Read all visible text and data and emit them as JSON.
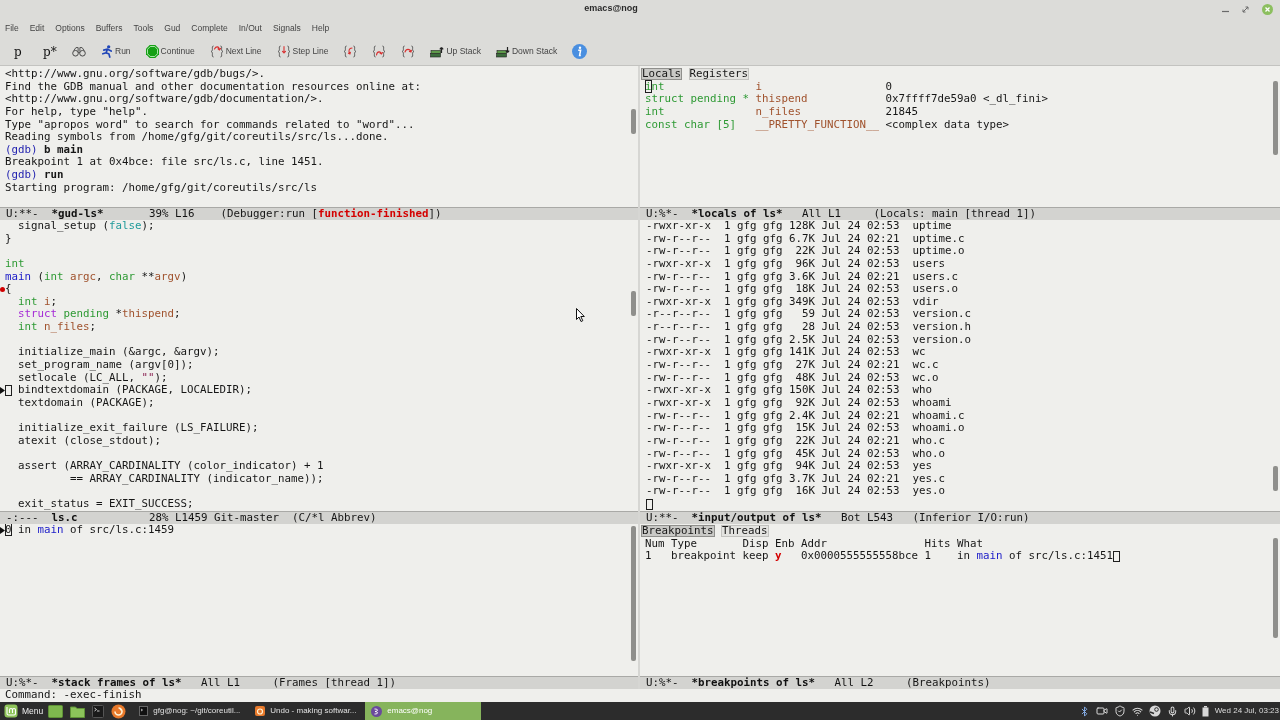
{
  "window": {
    "title": "emacs@nog"
  },
  "menu_bar": [
    "File",
    "Edit",
    "Options",
    "Buffers",
    "Tools",
    "Gud",
    "Complete",
    "In/Out",
    "Signals",
    "Help"
  ],
  "toolbar": [
    {
      "kind": "glyph",
      "label": "p"
    },
    {
      "kind": "glyph",
      "label": "p*"
    },
    {
      "kind": "icon"
    },
    {
      "kind": "labeled",
      "label": "Run"
    },
    {
      "kind": "labeled",
      "label": "Continue"
    },
    {
      "kind": "labeled",
      "label": "Next Line"
    },
    {
      "kind": "labeled",
      "label": "Step Line"
    },
    {
      "kind": "icon"
    },
    {
      "kind": "icon"
    },
    {
      "kind": "icon"
    },
    {
      "kind": "labeled",
      "label": "Up Stack"
    },
    {
      "kind": "labeled",
      "label": "Down Stack"
    },
    {
      "kind": "icon"
    }
  ],
  "gud_console": {
    "lines": [
      {
        "kind": "output",
        "text": "<http://www.gnu.org/software/gdb/bugs/>."
      },
      {
        "kind": "output",
        "text": "Find the GDB manual and other documentation resources online at:"
      },
      {
        "kind": "output",
        "text": "<http://www.gnu.org/software/gdb/documentation/>."
      },
      {
        "kind": "output",
        "text": "For help, type \"help\"."
      },
      {
        "kind": "output",
        "text": "Type \"apropos word\" to search for commands related to \"word\"..."
      },
      {
        "kind": "output",
        "text": "Reading symbols from /home/gfg/git/coreutils/src/ls...done."
      },
      {
        "kind": "command",
        "prompt": "(gdb)",
        "text": "b main"
      },
      {
        "kind": "output",
        "text": "Breakpoint 1 at 0x4bce: file src/ls.c, line 1451."
      },
      {
        "kind": "command",
        "prompt": "(gdb)",
        "text": "run"
      },
      {
        "kind": "output",
        "text": "Starting program: /home/gfg/git/coreutils/src/ls"
      }
    ],
    "mode_line": {
      "status": "U:**-",
      "buffer": "*gud-ls*",
      "position": "39% L16",
      "mode": [
        {
          "text": "(Debugger:run [",
          "kind": "plain"
        },
        {
          "text": "function-finished",
          "kind": "alert"
        },
        {
          "text": "])",
          "kind": "plain"
        }
      ]
    }
  },
  "locals": {
    "tabs": [
      {
        "label": "Locals",
        "selected": true
      },
      {
        "label": "Registers",
        "selected": false
      }
    ],
    "rows": [
      {
        "type": "int",
        "name": "i",
        "value": "0",
        "cursor": true
      },
      {
        "type": "struct pending *",
        "name": "thispend",
        "value": "0x7ffff7de59a0 <_dl_fini>",
        "cursor": false
      },
      {
        "type": "int",
        "name": "n_files",
        "value": "21845",
        "cursor": false
      },
      {
        "type": "const char [5]",
        "name": "__PRETTY_FUNCTION__",
        "value": "<complex data type>",
        "cursor": false
      }
    ],
    "mode_line": {
      "status": "U:%*-",
      "buffer": "*locals of ls*",
      "position": "All L1",
      "mode": [
        {
          "text": "(Locals: main [thread 1])",
          "kind": "plain"
        }
      ]
    }
  },
  "source": {
    "lines": [
      {
        "kind": "code",
        "breakpoint": false,
        "current": false,
        "cursor": false,
        "segments": [
          {
            "text": "  signal_setup (",
            "kind": "plain"
          },
          {
            "text": "false",
            "kind": "constant"
          },
          {
            "text": ");",
            "kind": "plain"
          }
        ]
      },
      {
        "kind": "code",
        "breakpoint": false,
        "current": false,
        "cursor": false,
        "segments": [
          {
            "text": "}",
            "kind": "plain"
          }
        ]
      },
      {
        "kind": "blank",
        "breakpoint": false,
        "current": false,
        "cursor": false
      },
      {
        "kind": "code",
        "breakpoint": false,
        "current": false,
        "cursor": false,
        "segments": [
          {
            "text": "int",
            "kind": "type"
          }
        ]
      },
      {
        "kind": "code",
        "breakpoint": false,
        "current": false,
        "cursor": false,
        "segments": [
          {
            "text": "main",
            "kind": "function"
          },
          {
            "text": " (",
            "kind": "plain"
          },
          {
            "text": "int",
            "kind": "type"
          },
          {
            "text": " argc",
            "kind": "variable"
          },
          {
            "text": ", ",
            "kind": "plain"
          },
          {
            "text": "char",
            "kind": "type"
          },
          {
            "text": " **",
            "kind": "plain"
          },
          {
            "text": "argv",
            "kind": "variable"
          },
          {
            "text": ")",
            "kind": "plain"
          }
        ]
      },
      {
        "kind": "code",
        "breakpoint": true,
        "current": false,
        "cursor": false,
        "segments": [
          {
            "text": "{",
            "kind": "plain"
          }
        ]
      },
      {
        "kind": "code",
        "breakpoint": false,
        "current": false,
        "cursor": false,
        "segments": [
          {
            "text": "  int",
            "kind": "type"
          },
          {
            "text": " i",
            "kind": "variable"
          },
          {
            "text": ";",
            "kind": "plain"
          }
        ]
      },
      {
        "kind": "code",
        "breakpoint": false,
        "current": false,
        "cursor": false,
        "segments": [
          {
            "text": "  struct",
            "kind": "keyword"
          },
          {
            "text": " pending",
            "kind": "type"
          },
          {
            "text": " *",
            "kind": "plain"
          },
          {
            "text": "thispend",
            "kind": "variable"
          },
          {
            "text": ";",
            "kind": "plain"
          }
        ]
      },
      {
        "kind": "code",
        "breakpoint": false,
        "current": false,
        "cursor": false,
        "segments": [
          {
            "text": "  int",
            "kind": "type"
          },
          {
            "text": " n_files",
            "kind": "variable"
          },
          {
            "text": ";",
            "kind": "plain"
          }
        ]
      },
      {
        "kind": "blank",
        "breakpoint": false,
        "current": false,
        "cursor": false
      },
      {
        "kind": "code",
        "breakpoint": false,
        "current": false,
        "cursor": false,
        "segments": [
          {
            "text": "  initialize_main (&argc, &argv);",
            "kind": "plain"
          }
        ]
      },
      {
        "kind": "code",
        "breakpoint": false,
        "current": false,
        "cursor": false,
        "segments": [
          {
            "text": "  set_program_name (argv[0]);",
            "kind": "plain"
          }
        ]
      },
      {
        "kind": "code",
        "breakpoint": false,
        "current": false,
        "cursor": false,
        "segments": [
          {
            "text": "  setlocale (LC_ALL, ",
            "kind": "plain"
          },
          {
            "text": "\"\"",
            "kind": "string"
          },
          {
            "text": ");",
            "kind": "plain"
          }
        ]
      },
      {
        "kind": "code",
        "breakpoint": false,
        "current": true,
        "cursor": true,
        "segments": [
          {
            "text": "  bindtextdomain (PACKAGE, LOCALEDIR);",
            "kind": "plain"
          }
        ]
      },
      {
        "kind": "code",
        "breakpoint": false,
        "current": false,
        "cursor": false,
        "segments": [
          {
            "text": "  textdomain (PACKAGE);",
            "kind": "plain"
          }
        ]
      },
      {
        "kind": "blank",
        "breakpoint": false,
        "current": false,
        "cursor": false
      },
      {
        "kind": "code",
        "breakpoint": false,
        "current": false,
        "cursor": false,
        "segments": [
          {
            "text": "  initialize_exit_failure (LS_FAILURE);",
            "kind": "plain"
          }
        ]
      },
      {
        "kind": "code",
        "breakpoint": false,
        "current": false,
        "cursor": false,
        "segments": [
          {
            "text": "  atexit (close_stdout);",
            "kind": "plain"
          }
        ]
      },
      {
        "kind": "blank",
        "breakpoint": false,
        "current": false,
        "cursor": false
      },
      {
        "kind": "code",
        "breakpoint": false,
        "current": false,
        "cursor": false,
        "segments": [
          {
            "text": "  assert (ARRAY_CARDINALITY (color_indicator) + 1",
            "kind": "plain"
          }
        ]
      },
      {
        "kind": "code",
        "breakpoint": false,
        "current": false,
        "cursor": false,
        "segments": [
          {
            "text": "          == ARRAY_CARDINALITY (indicator_name));",
            "kind": "plain"
          }
        ]
      },
      {
        "kind": "blank",
        "breakpoint": false,
        "current": false,
        "cursor": false
      },
      {
        "kind": "code",
        "breakpoint": false,
        "current": false,
        "cursor": false,
        "segments": [
          {
            "text": "  exit_status = EXIT_SUCCESS;",
            "kind": "plain"
          }
        ]
      }
    ],
    "mode_line": {
      "status": "-:---",
      "buffer": "ls.c",
      "position": "28% L1459",
      "vc": "Git-master",
      "mode": [
        {
          "text": "(C/*l Abbrev)",
          "kind": "plain"
        }
      ]
    }
  },
  "inferior_io": {
    "lines": [
      "-rwxr-xr-x  1 gfg gfg 128K Jul 24 02:53  uptime",
      "-rw-r--r--  1 gfg gfg 6.7K Jul 24 02:21  uptime.c",
      "-rw-r--r--  1 gfg gfg  22K Jul 24 02:53  uptime.o",
      "-rwxr-xr-x  1 gfg gfg  96K Jul 24 02:53  users",
      "-rw-r--r--  1 gfg gfg 3.6K Jul 24 02:21  users.c",
      "-rw-r--r--  1 gfg gfg  18K Jul 24 02:53  users.o",
      "-rwxr-xr-x  1 gfg gfg 349K Jul 24 02:53  vdir",
      "-r--r--r--  1 gfg gfg   59 Jul 24 02:53  version.c",
      "-r--r--r--  1 gfg gfg   28 Jul 24 02:53  version.h",
      "-rw-r--r--  1 gfg gfg 2.5K Jul 24 02:53  version.o",
      "-rwxr-xr-x  1 gfg gfg 141K Jul 24 02:53  wc",
      "-rw-r--r--  1 gfg gfg  27K Jul 24 02:21  wc.c",
      "-rw-r--r--  1 gfg gfg  48K Jul 24 02:53  wc.o",
      "-rwxr-xr-x  1 gfg gfg 150K Jul 24 02:53  who",
      "-rwxr-xr-x  1 gfg gfg  92K Jul 24 02:53  whoami",
      "-rw-r--r--  1 gfg gfg 2.4K Jul 24 02:21  whoami.c",
      "-rw-r--r--  1 gfg gfg  15K Jul 24 02:53  whoami.o",
      "-rw-r--r--  1 gfg gfg  22K Jul 24 02:21  who.c",
      "-rw-r--r--  1 gfg gfg  45K Jul 24 02:53  who.o",
      "-rwxr-xr-x  1 gfg gfg  94K Jul 24 02:53  yes",
      "-rw-r--r--  1 gfg gfg 3.7K Jul 24 02:21  yes.c",
      "-rw-r--r--  1 gfg gfg  16K Jul 24 02:53  yes.o"
    ],
    "input_line": {
      "cursor": true
    },
    "mode_line": {
      "status": "U:**-",
      "buffer": "*input/output of ls*",
      "position": "Bot L543",
      "mode": [
        {
          "text": "(Inferior I/O:run)",
          "kind": "plain"
        }
      ]
    }
  },
  "stack_frames": {
    "frames": [
      {
        "current": true,
        "cursor": true,
        "segments": [
          {
            "text": "0",
            "kind": "plain"
          },
          {
            "text": " in ",
            "kind": "plain"
          },
          {
            "text": "main",
            "kind": "function"
          },
          {
            "text": " of src/ls.c:1459",
            "kind": "plain"
          }
        ]
      }
    ],
    "mode_line": {
      "status": "U:%*-",
      "buffer": "*stack frames of ls*",
      "position": "All L1",
      "mode": [
        {
          "text": "(Frames [thread 1])",
          "kind": "plain"
        }
      ]
    }
  },
  "breakpoints": {
    "tabs": [
      {
        "label": "Breakpoints",
        "selected": true
      },
      {
        "label": "Threads",
        "selected": false
      }
    ],
    "columns": [
      "Num",
      "Type",
      "Disp",
      "Enb",
      "Addr",
      "Hits",
      "What"
    ],
    "rows": [
      {
        "num": "1",
        "type": "breakpoint",
        "disp": "keep",
        "enb": "y",
        "addr": "0x0000555555558bce",
        "hits": "1",
        "what": [
          {
            "text": "in ",
            "kind": "plain"
          },
          {
            "text": "main",
            "kind": "function"
          },
          {
            "text": " of src/ls.c:1451",
            "kind": "plain"
          }
        ],
        "cursor": true
      }
    ],
    "mode_line": {
      "status": "U:%*-",
      "buffer": "*breakpoints of ls*",
      "position": "All L2",
      "mode": [
        {
          "text": "(Breakpoints)",
          "kind": "plain"
        }
      ]
    }
  },
  "echo_area": {
    "text": "Command: -exec-finish"
  },
  "taskbar": {
    "menu_label": "Menu",
    "windows": [
      {
        "label": "gfg@nog: ~/git/coreutil...",
        "selected": false
      },
      {
        "label": "Undo - making softwar...",
        "selected": false
      },
      {
        "label": "emacs@nog",
        "selected": true
      }
    ],
    "clock": "Wed 24 Jul, 03:23"
  }
}
